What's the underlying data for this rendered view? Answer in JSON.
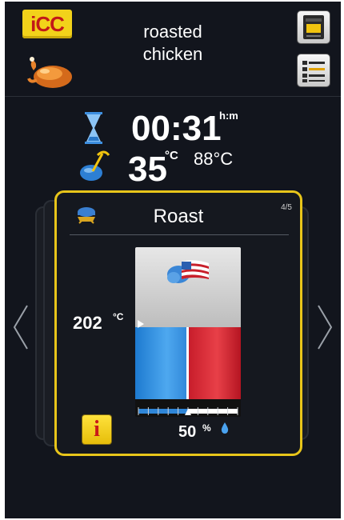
{
  "header": {
    "logo_text": "iCC",
    "title": "roasted\nchicken",
    "icons": {
      "logo": "icc-logo",
      "food": "chicken-icon",
      "oven": "oven-icon",
      "steps": "steps-list-icon"
    }
  },
  "status": {
    "time": "00:31",
    "time_unit": "h:m",
    "core_temp": "35",
    "core_temp_unit": "°C",
    "target_temp": "88°C",
    "icons": {
      "timer": "hourglass-icon",
      "probe": "core-probe-icon"
    }
  },
  "program": {
    "title": "Roast",
    "step": "4/5",
    "cabinet_temp": "202",
    "cabinet_temp_unit": "°C",
    "humidity_value": "50",
    "humidity_unit": "%",
    "humidity_fraction": 0.5,
    "icons": {
      "mode": "roast-mode-icon",
      "climate": "cloud-flag-icon",
      "info": "info-icon",
      "humidity": "water-drop-icon"
    },
    "info_glyph": "i"
  },
  "navigation": {
    "prev_icon": "chevron-left-icon",
    "next_icon": "chevron-right-icon"
  },
  "colors": {
    "background": "#12151d",
    "accent_yellow": "#e8c51a",
    "humidity_blue": "#2f86d8",
    "heat_red": "#d22a36"
  }
}
